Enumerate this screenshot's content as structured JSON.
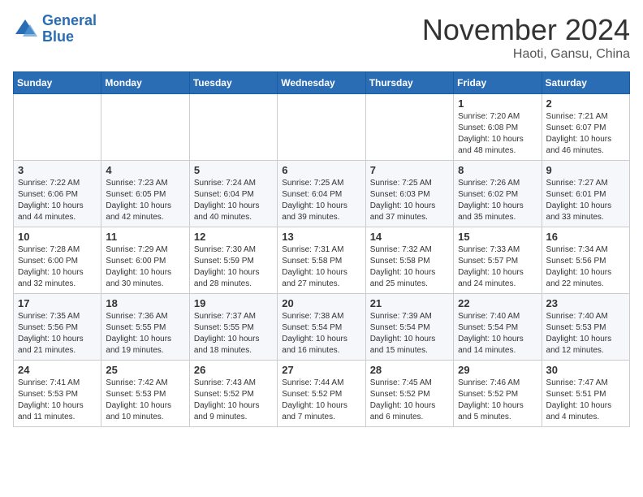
{
  "header": {
    "logo_line1": "General",
    "logo_line2": "Blue",
    "month": "November 2024",
    "location": "Haoti, Gansu, China"
  },
  "weekdays": [
    "Sunday",
    "Monday",
    "Tuesday",
    "Wednesday",
    "Thursday",
    "Friday",
    "Saturday"
  ],
  "weeks": [
    [
      {
        "day": "",
        "info": ""
      },
      {
        "day": "",
        "info": ""
      },
      {
        "day": "",
        "info": ""
      },
      {
        "day": "",
        "info": ""
      },
      {
        "day": "",
        "info": ""
      },
      {
        "day": "1",
        "info": "Sunrise: 7:20 AM\nSunset: 6:08 PM\nDaylight: 10 hours and 48 minutes."
      },
      {
        "day": "2",
        "info": "Sunrise: 7:21 AM\nSunset: 6:07 PM\nDaylight: 10 hours and 46 minutes."
      }
    ],
    [
      {
        "day": "3",
        "info": "Sunrise: 7:22 AM\nSunset: 6:06 PM\nDaylight: 10 hours and 44 minutes."
      },
      {
        "day": "4",
        "info": "Sunrise: 7:23 AM\nSunset: 6:05 PM\nDaylight: 10 hours and 42 minutes."
      },
      {
        "day": "5",
        "info": "Sunrise: 7:24 AM\nSunset: 6:04 PM\nDaylight: 10 hours and 40 minutes."
      },
      {
        "day": "6",
        "info": "Sunrise: 7:25 AM\nSunset: 6:04 PM\nDaylight: 10 hours and 39 minutes."
      },
      {
        "day": "7",
        "info": "Sunrise: 7:25 AM\nSunset: 6:03 PM\nDaylight: 10 hours and 37 minutes."
      },
      {
        "day": "8",
        "info": "Sunrise: 7:26 AM\nSunset: 6:02 PM\nDaylight: 10 hours and 35 minutes."
      },
      {
        "day": "9",
        "info": "Sunrise: 7:27 AM\nSunset: 6:01 PM\nDaylight: 10 hours and 33 minutes."
      }
    ],
    [
      {
        "day": "10",
        "info": "Sunrise: 7:28 AM\nSunset: 6:00 PM\nDaylight: 10 hours and 32 minutes."
      },
      {
        "day": "11",
        "info": "Sunrise: 7:29 AM\nSunset: 6:00 PM\nDaylight: 10 hours and 30 minutes."
      },
      {
        "day": "12",
        "info": "Sunrise: 7:30 AM\nSunset: 5:59 PM\nDaylight: 10 hours and 28 minutes."
      },
      {
        "day": "13",
        "info": "Sunrise: 7:31 AM\nSunset: 5:58 PM\nDaylight: 10 hours and 27 minutes."
      },
      {
        "day": "14",
        "info": "Sunrise: 7:32 AM\nSunset: 5:58 PM\nDaylight: 10 hours and 25 minutes."
      },
      {
        "day": "15",
        "info": "Sunrise: 7:33 AM\nSunset: 5:57 PM\nDaylight: 10 hours and 24 minutes."
      },
      {
        "day": "16",
        "info": "Sunrise: 7:34 AM\nSunset: 5:56 PM\nDaylight: 10 hours and 22 minutes."
      }
    ],
    [
      {
        "day": "17",
        "info": "Sunrise: 7:35 AM\nSunset: 5:56 PM\nDaylight: 10 hours and 21 minutes."
      },
      {
        "day": "18",
        "info": "Sunrise: 7:36 AM\nSunset: 5:55 PM\nDaylight: 10 hours and 19 minutes."
      },
      {
        "day": "19",
        "info": "Sunrise: 7:37 AM\nSunset: 5:55 PM\nDaylight: 10 hours and 18 minutes."
      },
      {
        "day": "20",
        "info": "Sunrise: 7:38 AM\nSunset: 5:54 PM\nDaylight: 10 hours and 16 minutes."
      },
      {
        "day": "21",
        "info": "Sunrise: 7:39 AM\nSunset: 5:54 PM\nDaylight: 10 hours and 15 minutes."
      },
      {
        "day": "22",
        "info": "Sunrise: 7:40 AM\nSunset: 5:54 PM\nDaylight: 10 hours and 14 minutes."
      },
      {
        "day": "23",
        "info": "Sunrise: 7:40 AM\nSunset: 5:53 PM\nDaylight: 10 hours and 12 minutes."
      }
    ],
    [
      {
        "day": "24",
        "info": "Sunrise: 7:41 AM\nSunset: 5:53 PM\nDaylight: 10 hours and 11 minutes."
      },
      {
        "day": "25",
        "info": "Sunrise: 7:42 AM\nSunset: 5:53 PM\nDaylight: 10 hours and 10 minutes."
      },
      {
        "day": "26",
        "info": "Sunrise: 7:43 AM\nSunset: 5:52 PM\nDaylight: 10 hours and 9 minutes."
      },
      {
        "day": "27",
        "info": "Sunrise: 7:44 AM\nSunset: 5:52 PM\nDaylight: 10 hours and 7 minutes."
      },
      {
        "day": "28",
        "info": "Sunrise: 7:45 AM\nSunset: 5:52 PM\nDaylight: 10 hours and 6 minutes."
      },
      {
        "day": "29",
        "info": "Sunrise: 7:46 AM\nSunset: 5:52 PM\nDaylight: 10 hours and 5 minutes."
      },
      {
        "day": "30",
        "info": "Sunrise: 7:47 AM\nSunset: 5:51 PM\nDaylight: 10 hours and 4 minutes."
      }
    ]
  ]
}
